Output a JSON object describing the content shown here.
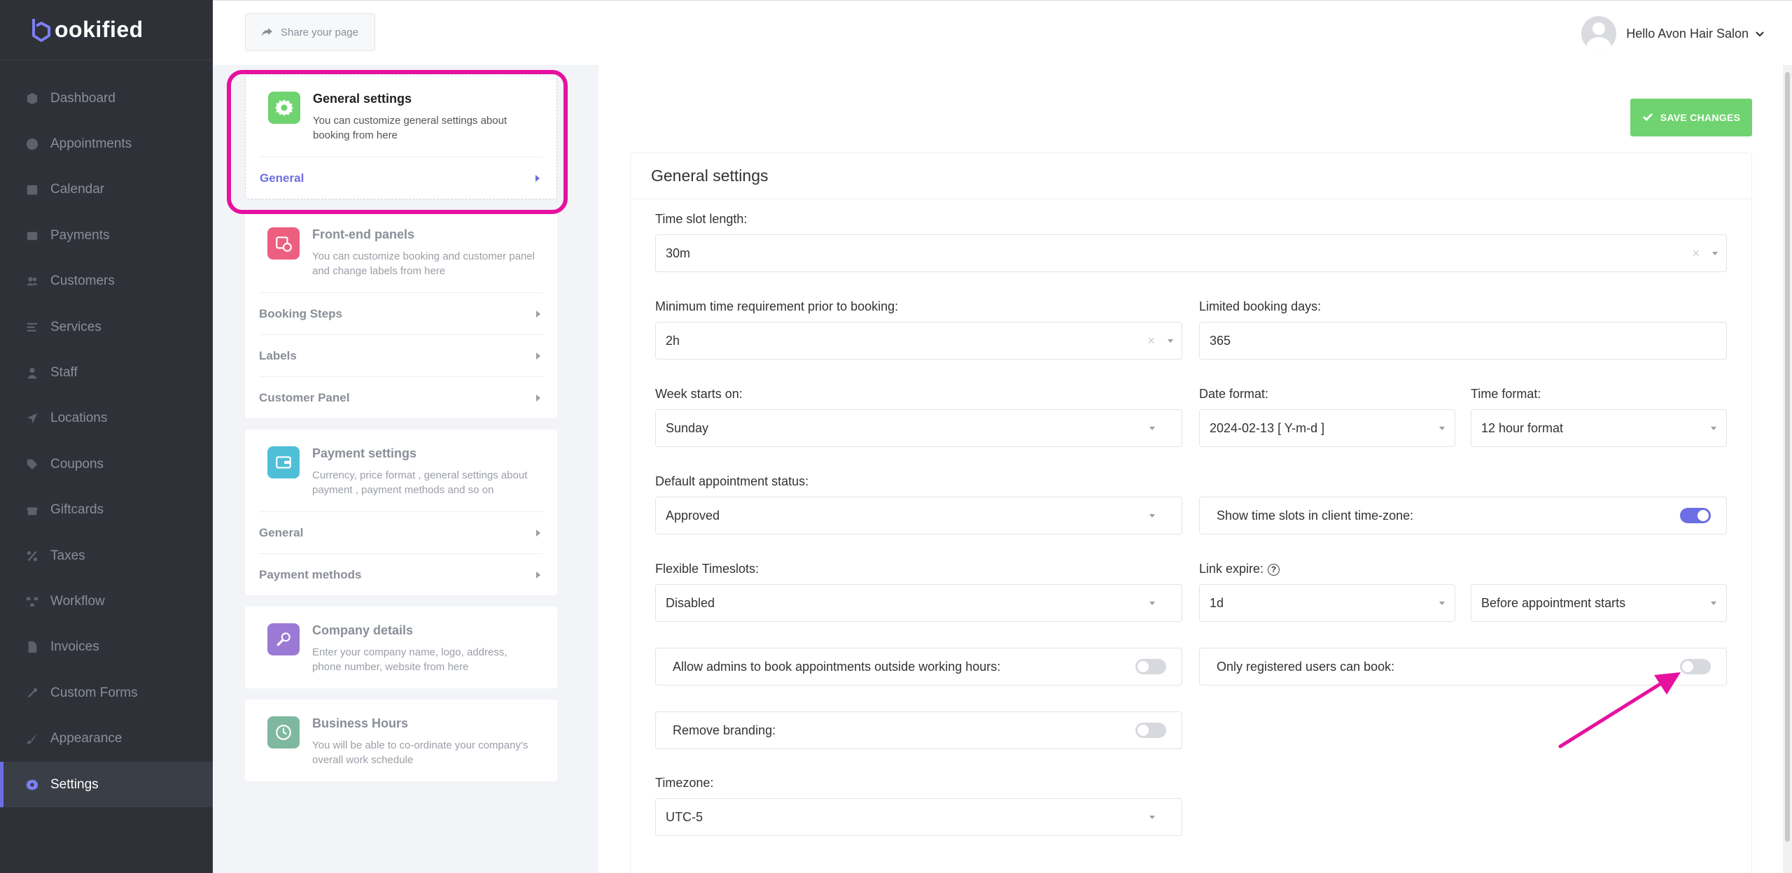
{
  "brand": {
    "logo_text": "ookified",
    "accent": "#6c6ee3"
  },
  "sidebar": {
    "items": [
      {
        "label": "Dashboard",
        "icon": "cube-icon"
      },
      {
        "label": "Appointments",
        "icon": "clock-icon"
      },
      {
        "label": "Calendar",
        "icon": "calendar-icon"
      },
      {
        "label": "Payments",
        "icon": "wallet-icon"
      },
      {
        "label": "Customers",
        "icon": "users-icon"
      },
      {
        "label": "Services",
        "icon": "list-icon"
      },
      {
        "label": "Staff",
        "icon": "user-icon"
      },
      {
        "label": "Locations",
        "icon": "location-arrow-icon"
      },
      {
        "label": "Coupons",
        "icon": "tag-icon"
      },
      {
        "label": "Giftcards",
        "icon": "gift-icon"
      },
      {
        "label": "Taxes",
        "icon": "percent-icon"
      },
      {
        "label": "Workflow",
        "icon": "workflow-icon"
      },
      {
        "label": "Invoices",
        "icon": "document-icon"
      },
      {
        "label": "Custom Forms",
        "icon": "tools-icon"
      },
      {
        "label": "Appearance",
        "icon": "brush-icon"
      },
      {
        "label": "Settings",
        "icon": "gear-icon",
        "active": true
      }
    ]
  },
  "topbar": {
    "share_label": "Share your page",
    "user_greeting": "Hello Avon Hair Salon"
  },
  "cards": [
    {
      "title": "General settings",
      "desc": "You can customize general settings about booking from here",
      "links": [
        "General"
      ],
      "color": "#6fd36f"
    },
    {
      "title": "Front-end panels",
      "desc": "You can customize booking and customer panel and change labels from here",
      "links": [
        "Booking Steps",
        "Labels",
        "Customer Panel"
      ],
      "color": "#ec5f7e"
    },
    {
      "title": "Payment settings",
      "desc": "Currency, price format , general settings about payment , payment methods and so on",
      "links": [
        "General",
        "Payment methods"
      ],
      "color": "#4fbfd8"
    },
    {
      "title": "Company details",
      "desc": "Enter your company name, logo, address, phone number, website from here",
      "links": [],
      "color": "#9b7ad6"
    },
    {
      "title": "Business Hours",
      "desc": "You will be able to co-ordinate your company's overall work schedule",
      "links": [],
      "color": "#7fb8a0"
    }
  ],
  "main": {
    "save_label": "SAVE CHANGES",
    "panel_title": "General settings",
    "fields": {
      "time_slot_length": {
        "label": "Time slot length:",
        "value": "30m"
      },
      "min_time_prior": {
        "label": "Minimum time requirement prior to booking:",
        "value": "2h"
      },
      "limited_booking_days": {
        "label": "Limited booking days:",
        "value": "365"
      },
      "week_starts_on": {
        "label": "Week starts on:",
        "value": "Sunday"
      },
      "date_format": {
        "label": "Date format:",
        "value": "2024-02-13 [ Y-m-d ]"
      },
      "time_format": {
        "label": "Time format:",
        "value": "12 hour format"
      },
      "default_status": {
        "label": "Default appointment status:",
        "value": "Approved"
      },
      "client_timezone": {
        "label": "Show time slots in client time-zone:",
        "on": true
      },
      "flexible_timeslots": {
        "label": "Flexible Timeslots:",
        "value": "Disabled"
      },
      "link_expire": {
        "label": "Link expire:",
        "value": "1d",
        "relative": "Before appointment starts"
      },
      "allow_admins": {
        "label": "Allow admins to book appointments outside working hours:",
        "on": false
      },
      "only_registered": {
        "label": "Only registered users can book:",
        "on": false
      },
      "remove_branding": {
        "label": "Remove branding:",
        "on": false
      },
      "timezone": {
        "label": "Timezone:",
        "value": "UTC-5"
      }
    }
  }
}
